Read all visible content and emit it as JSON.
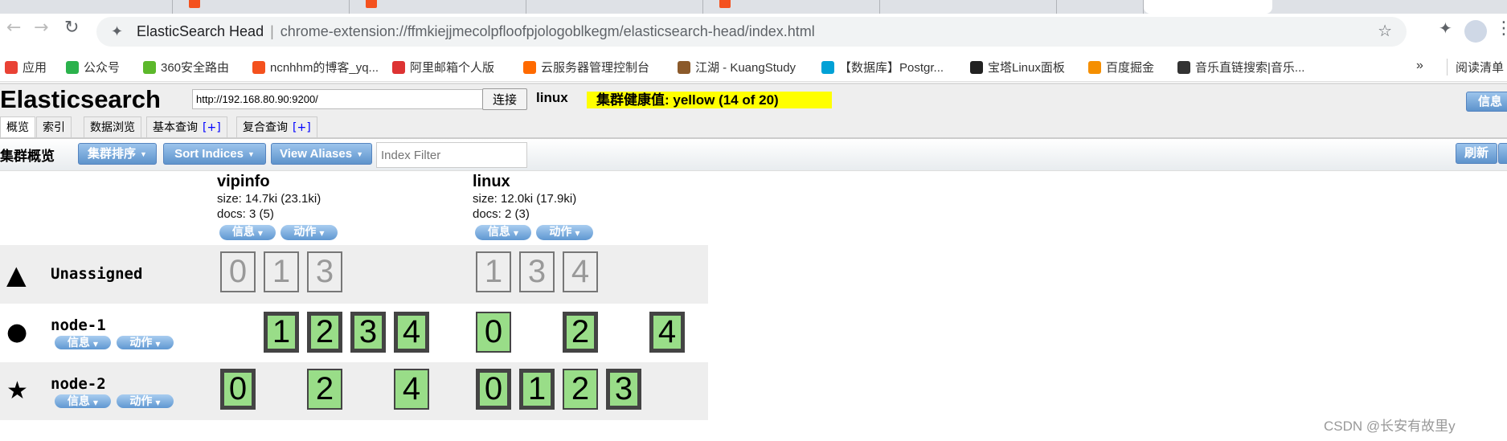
{
  "browser": {
    "page_title": "ElasticSearch Head",
    "url": "chrome-extension://ffmkiejjmecolpfloofpjologoblkegm/elasticsearch-head/index.html",
    "bookmarks": [
      {
        "label": "应用",
        "icon": "apps-grid-icon",
        "color": "#e94235"
      },
      {
        "label": "公众号",
        "icon": "wechat-icon",
        "color": "#2bb24c"
      },
      {
        "label": "360安全路由",
        "icon": "360-icon",
        "color": "#5cb82b"
      },
      {
        "label": "ncnhhm的博客_yq...",
        "icon": "csdn-icon",
        "color": "#f4511e"
      },
      {
        "label": "阿里邮箱个人版",
        "icon": "mail-icon",
        "color": "#d33"
      },
      {
        "label": "云服务器管理控制台",
        "icon": "aliyun-icon",
        "color": "#ff6a00"
      },
      {
        "label": "江湖 - KuangStudy",
        "icon": "avatar-icon",
        "color": "#8b5a2b"
      },
      {
        "label": "【数据库】Postgr...",
        "icon": "bilibili-icon",
        "color": "#00a1d6"
      },
      {
        "label": "宝塔Linux面板",
        "icon": "bt-icon",
        "color": "#222"
      },
      {
        "label": "百度掘金",
        "icon": "juejin-icon",
        "color": "#f58f00"
      },
      {
        "label": "音乐直链搜索|音乐...",
        "icon": "liu-icon",
        "color": "#333"
      }
    ],
    "more": "»",
    "reading_list": "阅读清单"
  },
  "header": {
    "title": "Elasticsearch",
    "url_value": "http://192.168.80.90:9200/",
    "connect": "连接",
    "cluster_name": "linux",
    "health": "集群健康值: yellow (14 of 20)",
    "health_color": "#ffff00",
    "info": "信息"
  },
  "tabs": [
    {
      "label": "概览",
      "plus": ""
    },
    {
      "label": "索引",
      "plus": ""
    },
    {
      "label": "数据浏览",
      "plus": ""
    },
    {
      "label": "基本查询",
      "plus": "[+]"
    },
    {
      "label": "复合查询",
      "plus": "[+]"
    }
  ],
  "toolbar": {
    "title": "集群概览",
    "sort_cluster": "集群排序",
    "sort_indices": "Sort Indices",
    "view_aliases": "View Aliases",
    "filter_placeholder": "Index Filter",
    "refresh": "刷新"
  },
  "indices": [
    {
      "name": "vipinfo",
      "size": "size: 14.7ki (23.1ki)",
      "docs": "docs: 3 (5)",
      "info": "信息",
      "action": "动作"
    },
    {
      "name": "linux",
      "size": "size: 12.0ki (17.9ki)",
      "docs": "docs: 2 (3)",
      "info": "信息",
      "action": "动作"
    }
  ],
  "rows": [
    {
      "name": "Unassigned",
      "icon": "warning-icon",
      "buttons": false,
      "shards": [
        [
          {
            "n": 0,
            "t": "un"
          },
          {
            "n": 1,
            "t": "un"
          },
          {
            "n": 3,
            "t": "un"
          }
        ],
        [
          {
            "n": 1,
            "t": "un"
          },
          {
            "n": 3,
            "t": "un"
          },
          {
            "n": 4,
            "t": "un"
          }
        ]
      ]
    },
    {
      "name": "node-1",
      "icon": "circle-icon",
      "buttons": true,
      "info": "信息",
      "action": "动作",
      "shards": [
        [
          {
            "n": 1,
            "t": "pri"
          },
          {
            "n": 2,
            "t": "pri"
          },
          {
            "n": 3,
            "t": "pri"
          },
          {
            "n": 4,
            "t": "pri"
          }
        ],
        [
          {
            "n": 0,
            "t": "rep"
          },
          {
            "n": 2,
            "t": "pri"
          },
          {
            "n": 4,
            "t": "pri"
          }
        ]
      ]
    },
    {
      "name": "node-2",
      "icon": "star-icon",
      "buttons": true,
      "info": "信息",
      "action": "动作",
      "shards": [
        [
          {
            "n": 0,
            "t": "pri"
          },
          {
            "n": 2,
            "t": "rep"
          },
          {
            "n": 4,
            "t": "rep"
          }
        ],
        [
          {
            "n": 0,
            "t": "pri"
          },
          {
            "n": 1,
            "t": "pri"
          },
          {
            "n": 2,
            "t": "rep"
          },
          {
            "n": 3,
            "t": "pri"
          }
        ]
      ]
    }
  ],
  "watermark": "CSDN @长安有故里y"
}
